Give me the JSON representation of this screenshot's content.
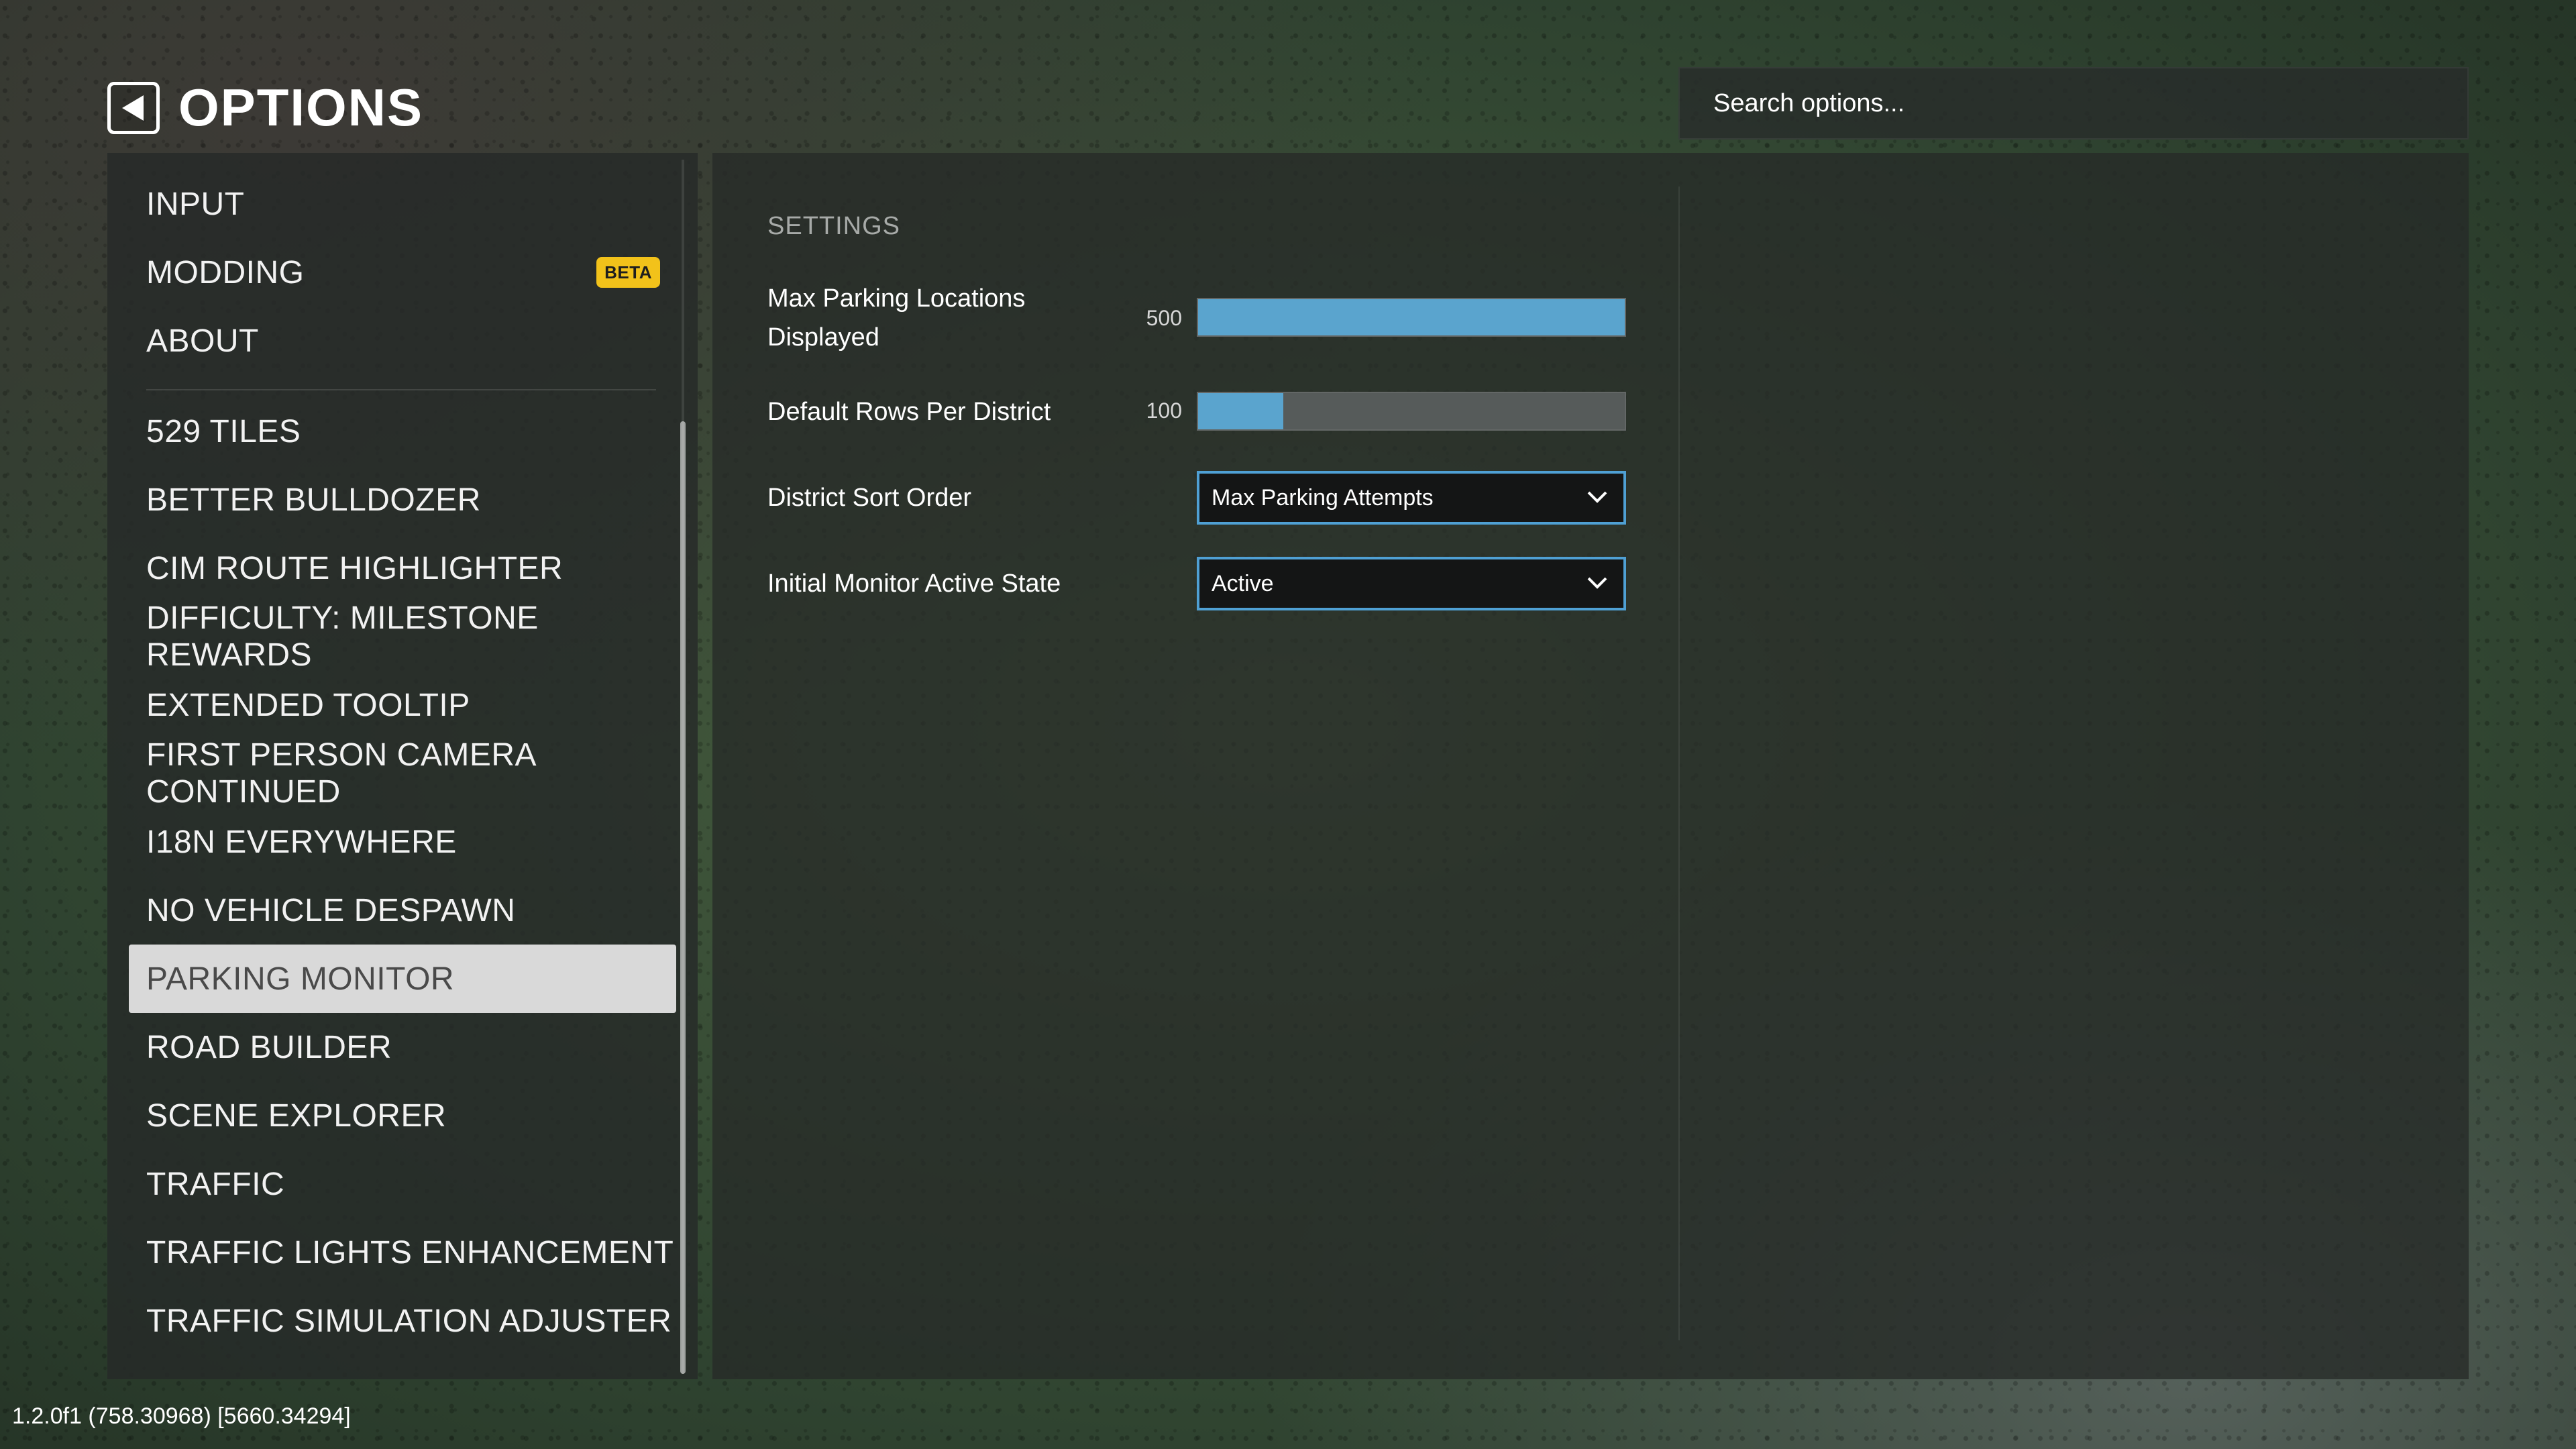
{
  "header": {
    "title": "OPTIONS"
  },
  "search": {
    "placeholder": "Search options..."
  },
  "sidebar": {
    "top_items": [
      {
        "label": "INPUT"
      },
      {
        "label": "MODDING",
        "badge": "BETA"
      },
      {
        "label": "ABOUT"
      }
    ],
    "mod_items": [
      {
        "label": "529 TILES"
      },
      {
        "label": "BETTER BULLDOZER"
      },
      {
        "label": "CIM ROUTE HIGHLIGHTER"
      },
      {
        "label": "DIFFICULTY: MILESTONE REWARDS"
      },
      {
        "label": "EXTENDED TOOLTIP"
      },
      {
        "label": "FIRST PERSON CAMERA CONTINUED"
      },
      {
        "label": "I18N EVERYWHERE"
      },
      {
        "label": "NO VEHICLE DESPAWN"
      },
      {
        "label": "PARKING MONITOR",
        "selected": true
      },
      {
        "label": "ROAD BUILDER"
      },
      {
        "label": "SCENE EXPLORER"
      },
      {
        "label": "TRAFFIC"
      },
      {
        "label": "TRAFFIC LIGHTS ENHANCEMENT"
      },
      {
        "label": "TRAFFIC SIMULATION ADJUSTER"
      }
    ]
  },
  "settings": {
    "section_title": "SETTINGS",
    "max_parking": {
      "label": "Max Parking Locations Displayed",
      "value": "500",
      "fill_fraction": 1.0
    },
    "default_rows": {
      "label": "Default Rows Per District",
      "value": "100",
      "fill_fraction": 0.2
    },
    "sort_order": {
      "label": "District Sort Order",
      "selected": "Max Parking Attempts"
    },
    "monitor_state": {
      "label": "Initial Monitor Active State",
      "selected": "Active"
    }
  },
  "colors": {
    "accent": "#5aa4ce",
    "beta_badge": "#f2c21a",
    "selected_item": "#d9d9d9"
  },
  "icons": {
    "back": "back-arrow-icon",
    "dropdown": "chevron-down-icon"
  },
  "footer": {
    "version": "1.2.0f1 (758.30968) [5660.34294]"
  }
}
